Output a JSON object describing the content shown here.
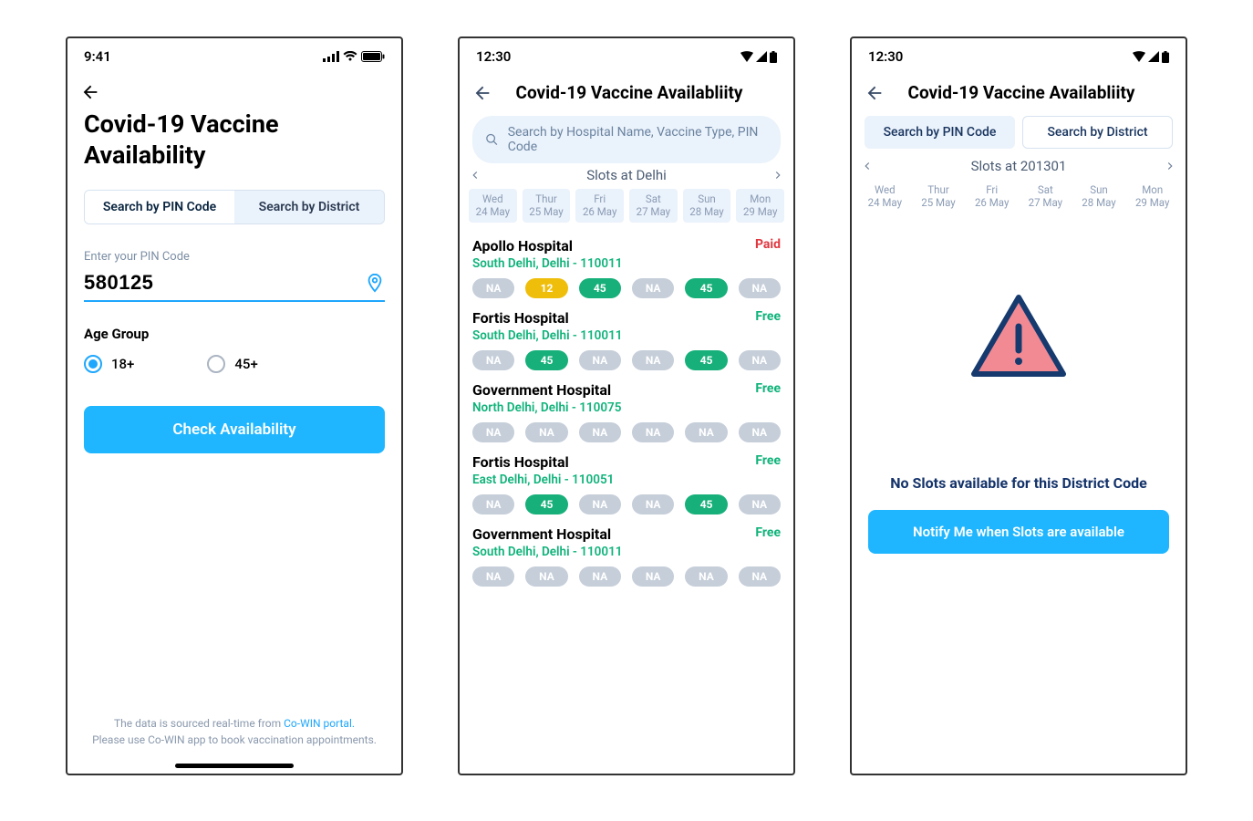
{
  "screen1": {
    "status_time": "9:41",
    "title": "Covid-19 Vaccine Availability",
    "tabs": {
      "pin": "Search by PIN Code",
      "district": "Search by District"
    },
    "pin_label": "Enter your PIN Code",
    "pin_value": "580125",
    "age_label": "Age Group",
    "age_options": {
      "a18": "18+",
      "a45": "45+"
    },
    "check_btn": "Check Availability",
    "footer1": "The data is sourced real-time from ",
    "footer_link": "Co-WIN portal.",
    "footer2": "Please use Co-WIN app to book vaccination appointments."
  },
  "screen2": {
    "status_time": "12:30",
    "title": "Covid-19 Vaccine Availabliity",
    "search_placeholder": "Search by Hospital Name, Vaccine Type, PIN Code",
    "slots_at": "Slots at Delhi",
    "days": [
      {
        "dow": "Wed",
        "date": "24 May"
      },
      {
        "dow": "Thur",
        "date": "25 May"
      },
      {
        "dow": "Fri",
        "date": "26 May"
      },
      {
        "dow": "Sat",
        "date": "27 May"
      },
      {
        "dow": "Sun",
        "date": "28 May"
      },
      {
        "dow": "Mon",
        "date": "29 May"
      }
    ],
    "hospitals": [
      {
        "name": "Apollo Hospital",
        "addr": "South Delhi, Delhi - 110011",
        "tag": "Paid",
        "tag_type": "paid",
        "slots": [
          {
            "v": "NA",
            "t": "na"
          },
          {
            "v": "12",
            "t": "yellow"
          },
          {
            "v": "45",
            "t": "green"
          },
          {
            "v": "NA",
            "t": "na"
          },
          {
            "v": "45",
            "t": "green"
          },
          {
            "v": "NA",
            "t": "na"
          }
        ]
      },
      {
        "name": "Fortis Hospital",
        "addr": "South Delhi, Delhi - 110011",
        "tag": "Free",
        "tag_type": "free",
        "slots": [
          {
            "v": "NA",
            "t": "na"
          },
          {
            "v": "45",
            "t": "green"
          },
          {
            "v": "NA",
            "t": "na"
          },
          {
            "v": "NA",
            "t": "na"
          },
          {
            "v": "45",
            "t": "green"
          },
          {
            "v": "NA",
            "t": "na"
          }
        ]
      },
      {
        "name": "Government Hospital",
        "addr": "North Delhi, Delhi - 110075",
        "tag": "Free",
        "tag_type": "free",
        "slots": [
          {
            "v": "NA",
            "t": "na"
          },
          {
            "v": "NA",
            "t": "na"
          },
          {
            "v": "NA",
            "t": "na"
          },
          {
            "v": "NA",
            "t": "na"
          },
          {
            "v": "NA",
            "t": "na"
          },
          {
            "v": "NA",
            "t": "na"
          }
        ]
      },
      {
        "name": "Fortis Hospital",
        "addr": "East Delhi, Delhi - 110051",
        "tag": "Free",
        "tag_type": "free",
        "slots": [
          {
            "v": "NA",
            "t": "na"
          },
          {
            "v": "45",
            "t": "green"
          },
          {
            "v": "NA",
            "t": "na"
          },
          {
            "v": "NA",
            "t": "na"
          },
          {
            "v": "45",
            "t": "green"
          },
          {
            "v": "NA",
            "t": "na"
          }
        ]
      },
      {
        "name": "Government Hospital",
        "addr": "South Delhi, Delhi - 110011",
        "tag": "Free",
        "tag_type": "free",
        "slots": [
          {
            "v": "NA",
            "t": "na"
          },
          {
            "v": "NA",
            "t": "na"
          },
          {
            "v": "NA",
            "t": "na"
          },
          {
            "v": "NA",
            "t": "na"
          },
          {
            "v": "NA",
            "t": "na"
          },
          {
            "v": "NA",
            "t": "na"
          }
        ]
      }
    ]
  },
  "screen3": {
    "status_time": "12:30",
    "title": "Covid-19 Vaccine Availabliity",
    "tabs": {
      "pin": "Search by PIN Code",
      "district": "Search by District"
    },
    "slots_at": "Slots at 201301",
    "days": [
      {
        "dow": "Wed",
        "date": "24 May"
      },
      {
        "dow": "Thur",
        "date": "25 May"
      },
      {
        "dow": "Fri",
        "date": "26 May"
      },
      {
        "dow": "Sat",
        "date": "27 May"
      },
      {
        "dow": "Sun",
        "date": "28 May"
      },
      {
        "dow": "Mon",
        "date": "29 May"
      }
    ],
    "empty_text": "No Slots available for this District Code",
    "notify_btn": "Notify Me when Slots are available"
  }
}
